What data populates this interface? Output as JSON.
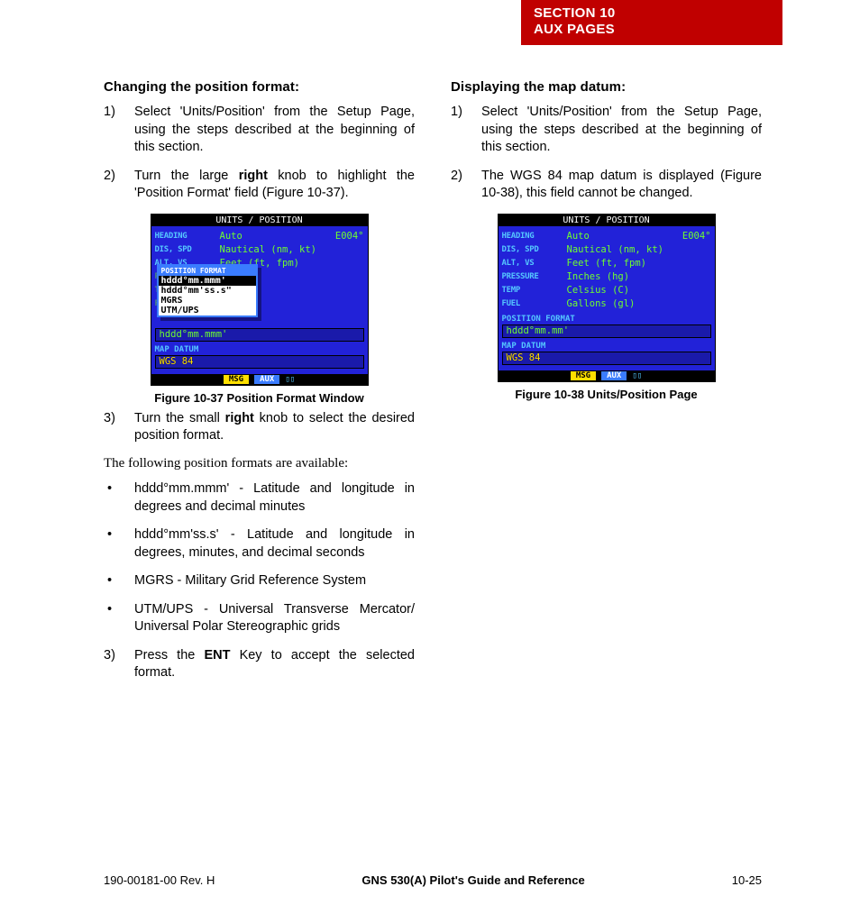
{
  "header": {
    "line1": "SECTION 10",
    "line2": "AUX PAGES"
  },
  "left": {
    "heading": "Changing the position format:",
    "steps_a": [
      {
        "n": "1)",
        "t": "Select 'Units/Position' from the Setup Page, using the steps described at the beginning of this section."
      },
      {
        "n": "2)",
        "pre": "Turn the large ",
        "bold": "right",
        "post": " knob to highlight the 'Position Format' field (Figure 10-37)."
      }
    ],
    "fig37": {
      "title": "UNITS / POSITION",
      "rows": [
        {
          "lbl": "HEADING",
          "val": "Auto",
          "r": "E004°"
        },
        {
          "lbl": "DIS, SPD",
          "val": "Nautical (nm, kt)"
        },
        {
          "lbl": "ALT, VS",
          "val": "Feet (ft, fpm)"
        }
      ],
      "popup_title": "POSITION FORMAT",
      "popup_items": [
        "hddd°mm.mmm'",
        "hddd°mm'ss.s\"",
        "MGRS",
        "UTM/UPS"
      ],
      "posfmt_label": "POSITION FORMAT",
      "posfmt_val": "hddd°mm.mmm'",
      "datum_label": "MAP DATUM",
      "datum_val": "WGS 84",
      "msg": "MSG",
      "aux": "AUX",
      "caption": "Figure 10-37  Position Format Window"
    },
    "steps_b": [
      {
        "n": "3)",
        "pre": "Turn the small ",
        "bold": "right",
        "post": " knob to select the desired position format."
      }
    ],
    "intro": "The following position formats are available:",
    "bullets": [
      "hddd°mm.mmm' - Latitude and longitude in degrees and decimal minutes",
      "hddd°mm'ss.s' - Latitude and longitude in degrees, minutes, and decimal seconds",
      "MGRS - Military Grid Reference System",
      "UTM/UPS - Universal Transverse Mercator/ Universal Polar Stereographic grids"
    ],
    "steps_c": [
      {
        "n": "3)",
        "pre": "Press the ",
        "bold": "ENT",
        "post": " Key to accept the selected format."
      }
    ]
  },
  "right": {
    "heading": "Displaying the map datum:",
    "steps": [
      {
        "n": "1)",
        "t": "Select 'Units/Position' from the Setup Page, using the steps described at the beginning of this section."
      },
      {
        "n": "2)",
        "t": "The WGS 84 map datum is displayed (Figure 10-38), this field cannot be changed."
      }
    ],
    "fig38": {
      "title": "UNITS / POSITION",
      "rows": [
        {
          "lbl": "HEADING",
          "val": "Auto",
          "r": "E004°"
        },
        {
          "lbl": "DIS, SPD",
          "val": "Nautical (nm, kt)"
        },
        {
          "lbl": "ALT, VS",
          "val": "Feet (ft, fpm)"
        },
        {
          "lbl": "PRESSURE",
          "val": "Inches (hg)"
        },
        {
          "lbl": "TEMP",
          "val": "Celsius (C)"
        },
        {
          "lbl": "FUEL",
          "val": "Gallons (gl)"
        }
      ],
      "posfmt_label": "POSITION FORMAT",
      "posfmt_val": "hddd°mm.mm'",
      "datum_label": "MAP DATUM",
      "datum_val": "WGS 84",
      "msg": "MSG",
      "aux": "AUX",
      "caption": "Figure 10-38  Units/Position Page"
    }
  },
  "footer": {
    "left": "190-00181-00  Rev. H",
    "center": "GNS 530(A) Pilot's Guide and Reference",
    "right": "10-25"
  }
}
